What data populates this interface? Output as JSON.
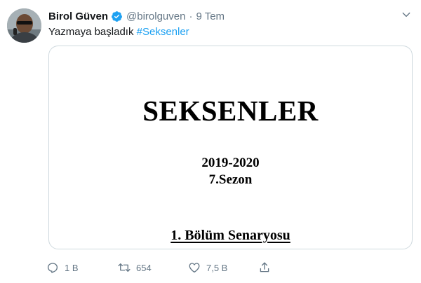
{
  "tweet": {
    "author": {
      "display_name": "Birol Güven",
      "handle": "@birolguven",
      "verified": true
    },
    "separator": "·",
    "timestamp": "9 Tem",
    "text": "Yazmaya başladık",
    "hashtag": "#Seksenler",
    "media": {
      "title": "SEKSENLER",
      "years": "2019-2020",
      "season": "7.Sezon",
      "episode": "1. Bölüm Senaryosu"
    },
    "actions": {
      "reply_count": "1 B",
      "retweet_count": "654",
      "like_count": "7,5 B"
    }
  },
  "colors": {
    "accent": "#1da1f2",
    "muted": "#657786",
    "text": "#14171a",
    "border": "#cfd9de"
  },
  "icons": {
    "verified": "verified-badge-icon",
    "caret": "chevron-down-icon",
    "reply": "reply-icon",
    "retweet": "retweet-icon",
    "like": "heart-icon",
    "share": "share-icon"
  }
}
